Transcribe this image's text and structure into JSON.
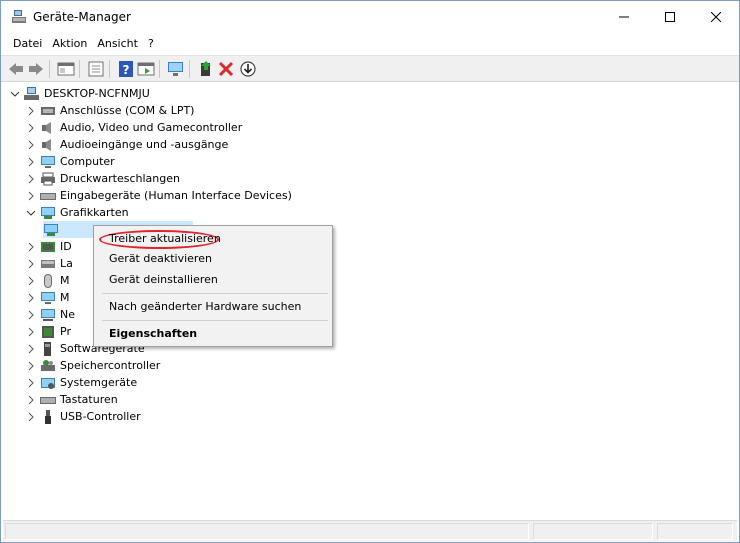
{
  "window": {
    "title": "Geräte-Manager"
  },
  "menu": [
    "Datei",
    "Aktion",
    "Ansicht",
    "?"
  ],
  "tree": {
    "root": "DESKTOP-NCFNMJU",
    "categories": [
      {
        "label": "Anschlüsse (COM & LPT)",
        "icon": "port-icon"
      },
      {
        "label": "Audio, Video und Gamecontroller",
        "icon": "speaker-icon"
      },
      {
        "label": "Audioeingänge und -ausgänge",
        "icon": "speaker-icon"
      },
      {
        "label": "Computer",
        "icon": "monitor-icon"
      },
      {
        "label": "Druckwarteschlangen",
        "icon": "printer-icon"
      },
      {
        "label": "Eingabegeräte (Human Interface Devices)",
        "icon": "keyboard-icon"
      },
      {
        "label": "Grafikkarten",
        "icon": "display-adapter-icon",
        "expanded": true
      },
      {
        "label": "",
        "icon": "display-adapter-icon",
        "child": true
      },
      {
        "label": "ID",
        "icon": "ide-icon"
      },
      {
        "label": "La",
        "icon": "drive-icon"
      },
      {
        "label": "M",
        "icon": "mouse-icon"
      },
      {
        "label": "M",
        "icon": "monitor-icon"
      },
      {
        "label": "Ne",
        "icon": "network-icon"
      },
      {
        "label": "Pr",
        "icon": "processor-icon"
      },
      {
        "label": "Softwaregeräte",
        "icon": "software-icon"
      },
      {
        "label": "Speichercontroller",
        "icon": "storage-icon"
      },
      {
        "label": "Systemgeräte",
        "icon": "system-icon"
      },
      {
        "label": "Tastaturen",
        "icon": "keyboard-icon"
      },
      {
        "label": "USB-Controller",
        "icon": "usb-icon"
      }
    ]
  },
  "context_menu": {
    "update_driver": "Treiber aktualisieren",
    "disable": "Gerät deaktivieren",
    "uninstall": "Gerät deinstallieren",
    "scan": "Nach geänderter Hardware suchen",
    "properties": "Eigenschaften"
  },
  "colors": {
    "highlight": "#e0262a",
    "selection": "#cce8ff"
  }
}
